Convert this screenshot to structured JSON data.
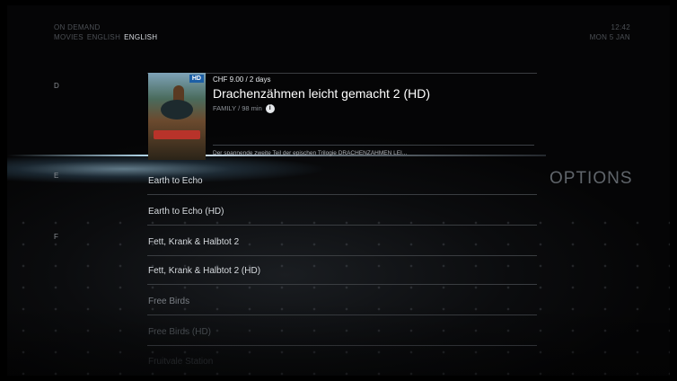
{
  "header": {
    "section": "ON DEMAND",
    "breadcrumb_parent": "MOVIES",
    "breadcrumb_sub": "ENGLISH",
    "breadcrumb_active": "ENGLISH",
    "clock": "12:42",
    "date": "MON 5 JAN"
  },
  "letters": [
    "D",
    "E",
    "F"
  ],
  "focused_item": {
    "price": "CHF 9.00 / 2 days",
    "title": "Drachenzähmen leicht gemacht 2 (HD)",
    "meta": "FAMILY / 98 min",
    "info_icon": "info-icon",
    "description": "Der spannende zweite Teil der epischen Trilogie DRACHENZÄHMEN LEI...",
    "poster_badge": "HD"
  },
  "list": [
    {
      "label": "Earth to Echo",
      "color": "#d7dbdf"
    },
    {
      "label": "Earth to Echo (HD)",
      "color": "#d7dbdf"
    },
    {
      "label": "Fett, Krank & Halbtot 2",
      "color": "#d7dbdf"
    },
    {
      "label": "Fett, Krank & Halbtot 2 (HD)",
      "color": "#d7dbdf"
    },
    {
      "label": "Free Birds",
      "color": "#7a7f85"
    },
    {
      "label": "Free Birds (HD)",
      "color": "#4f5459"
    },
    {
      "label": "Fruitvale Station",
      "color": "#2f3337"
    }
  ],
  "options_label": "OPTIONS"
}
